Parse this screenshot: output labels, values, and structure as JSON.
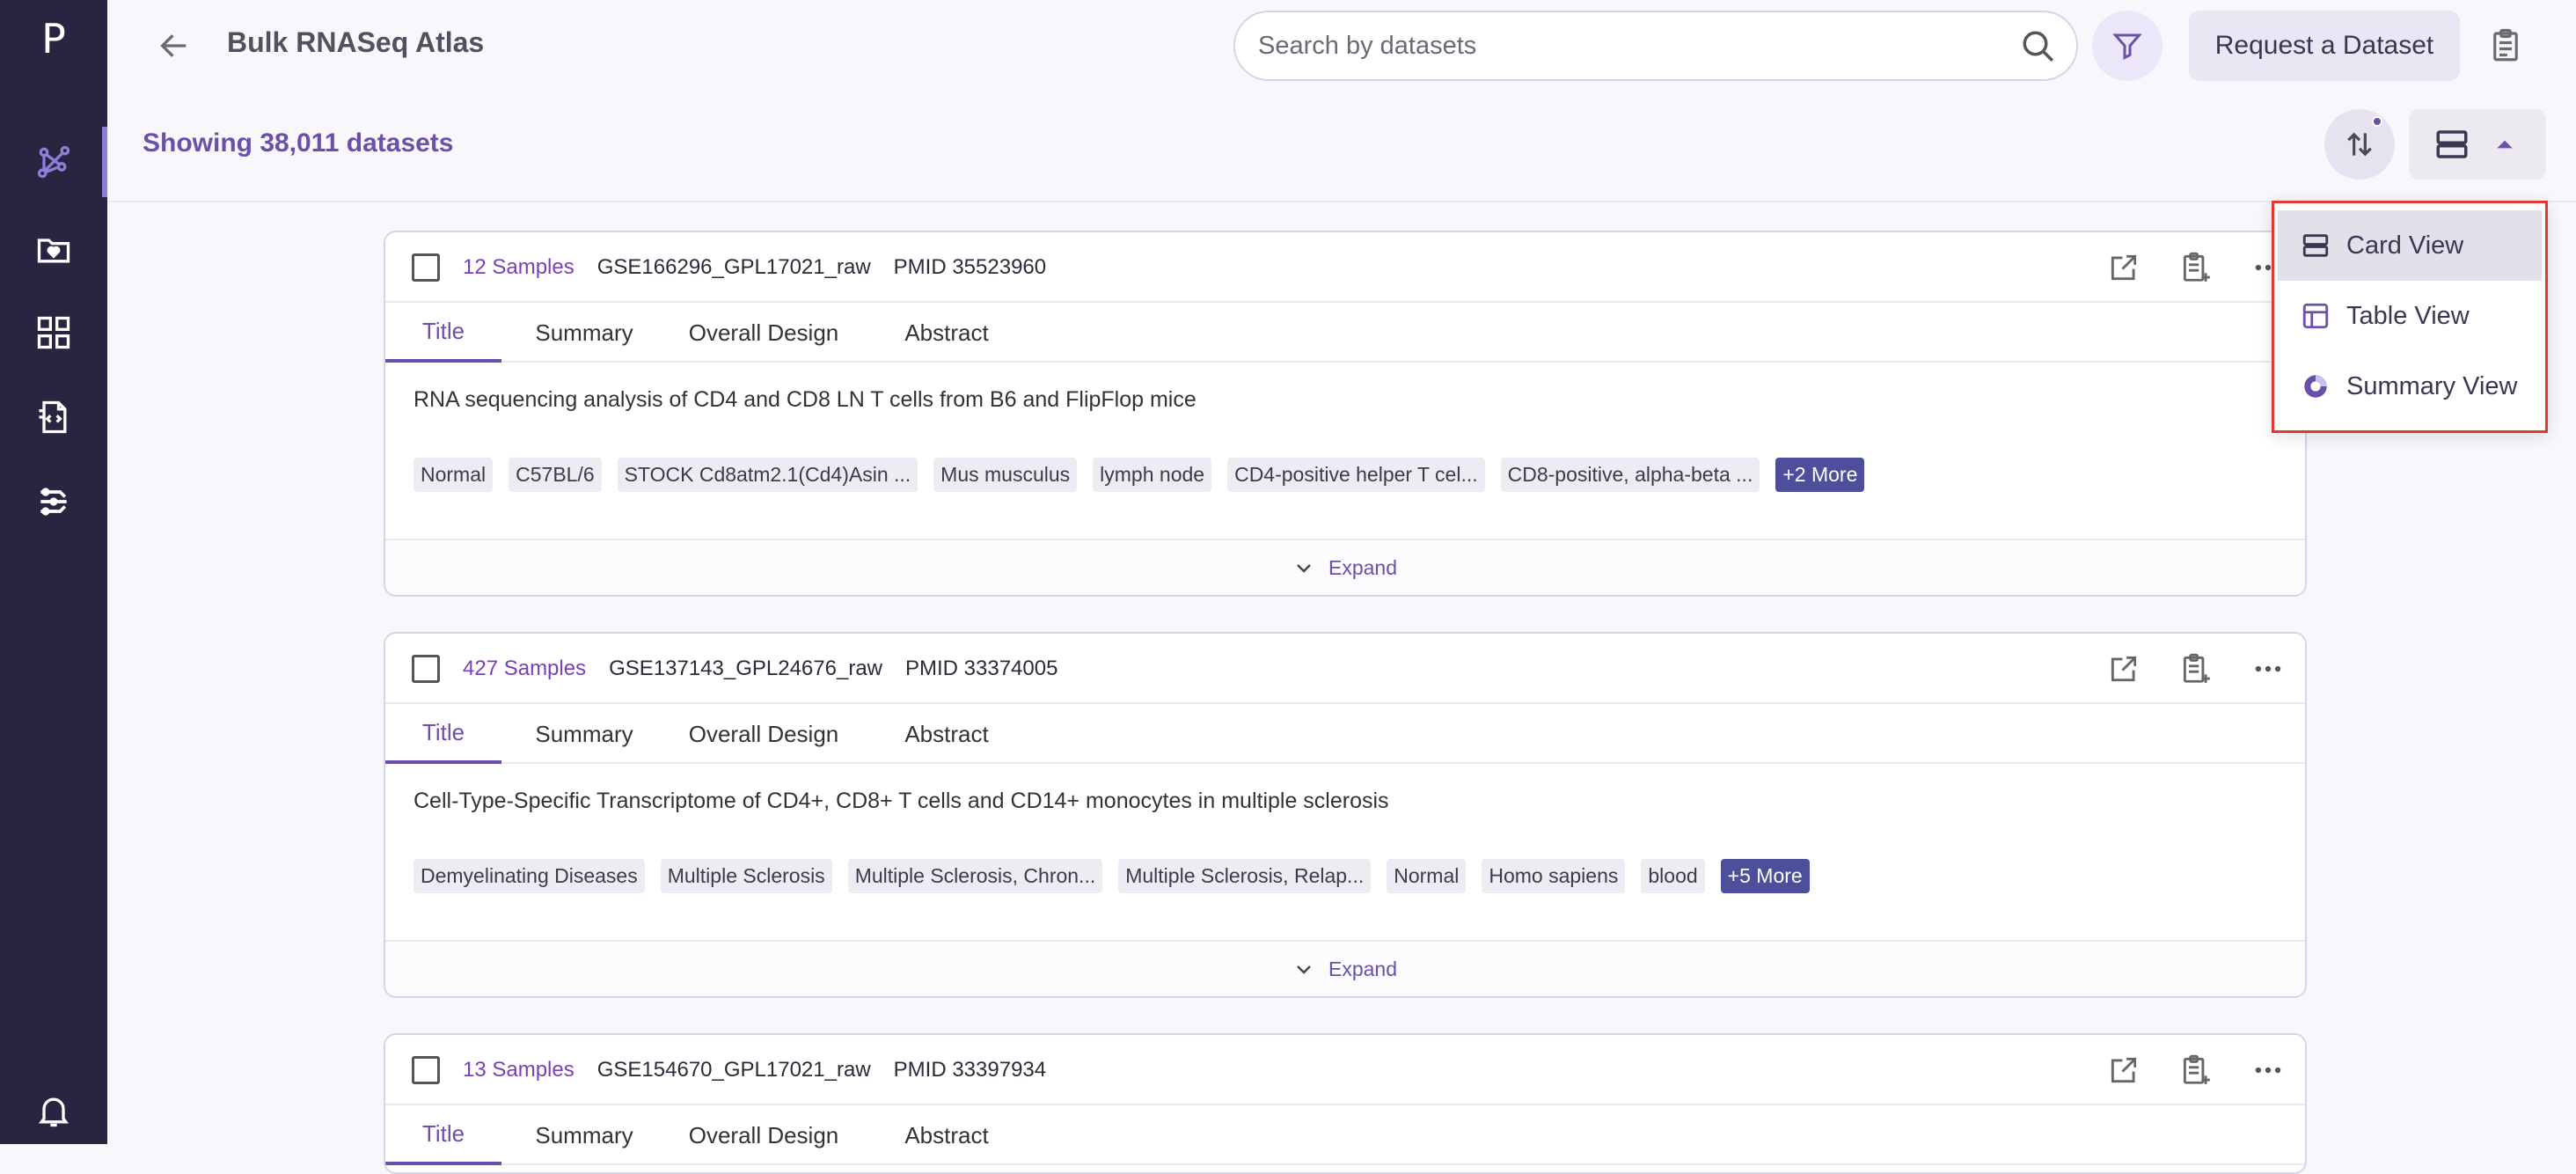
{
  "app": {
    "logo": "P"
  },
  "sidebar": {
    "items": [
      {
        "id": "graph",
        "icon": "network-graph-icon"
      },
      {
        "id": "folder",
        "icon": "folder-heart-icon"
      },
      {
        "id": "apps",
        "icon": "grid-icon"
      },
      {
        "id": "docs",
        "icon": "document-code-icon"
      },
      {
        "id": "pipelines",
        "icon": "pipeline-icon"
      },
      {
        "id": "notifications",
        "icon": "bell-icon"
      }
    ]
  },
  "header": {
    "title": "Bulk RNASeq Atlas",
    "search_placeholder": "Search by datasets",
    "request_label": "Request a Dataset"
  },
  "results": {
    "showing": "Showing 38,011 datasets"
  },
  "view_menu": {
    "items": [
      {
        "label": "Card View",
        "icon": "card-view-icon",
        "selected": true
      },
      {
        "label": "Table View",
        "icon": "table-view-icon",
        "selected": false
      },
      {
        "label": "Summary View",
        "icon": "summary-view-icon",
        "selected": false
      }
    ]
  },
  "tabs": [
    "Title",
    "Summary",
    "Overall Design",
    "Abstract"
  ],
  "expand_label": "Expand",
  "cards": [
    {
      "samples": "12 Samples",
      "accession": "GSE166296_GPL17021_raw",
      "pmid": "PMID 35523960",
      "title": "RNA sequencing analysis of CD4 and CD8 LN T cells from B6 and FlipFlop mice",
      "tags": [
        "Normal",
        "C57BL/6",
        "STOCK Cd8atm2.1(Cd4)Asin ...",
        "Mus musculus",
        "lymph node",
        "CD4-positive helper T cel...",
        "CD8-positive, alpha-beta ..."
      ],
      "more": "+2 More"
    },
    {
      "samples": "427 Samples",
      "accession": "GSE137143_GPL24676_raw",
      "pmid": "PMID 33374005",
      "title": "Cell-Type-Specific Transcriptome of CD4+, CD8+ T cells and CD14+ monocytes in multiple sclerosis",
      "tags": [
        "Demyelinating Diseases",
        "Multiple Sclerosis",
        "Multiple Sclerosis, Chron...",
        "Multiple Sclerosis, Relap...",
        "Normal",
        "Homo sapiens",
        "blood"
      ],
      "more": "+5 More"
    },
    {
      "samples": "13 Samples",
      "accession": "GSE154670_GPL17021_raw",
      "pmid": "PMID 33397934"
    }
  ]
}
